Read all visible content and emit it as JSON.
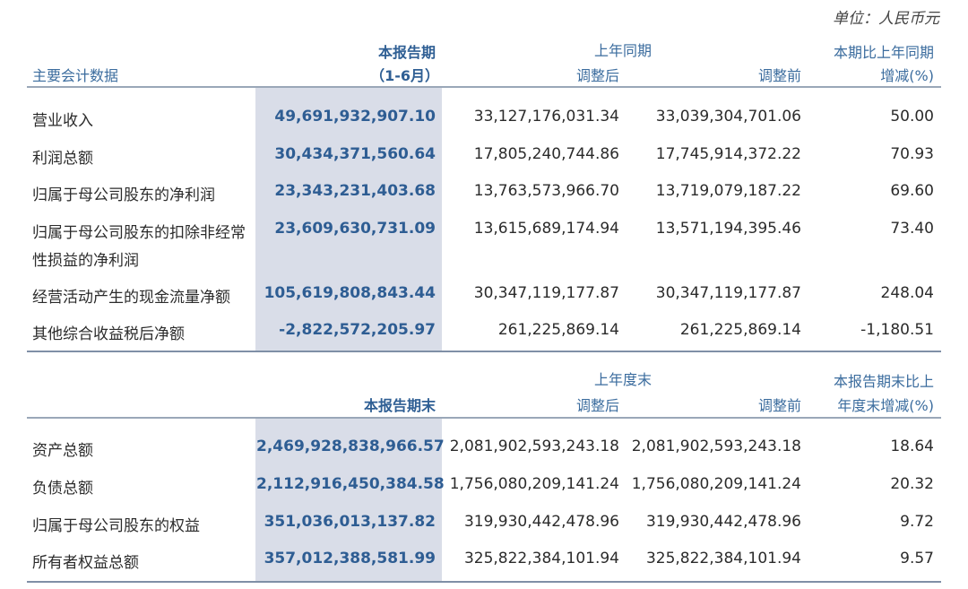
{
  "unit": "单位：人民币元",
  "section1": {
    "headers": {
      "item": "主要会计数据",
      "current_line1": "本报告期",
      "current_line2": "（1-6月）",
      "prior_group": "上年同期",
      "adjusted": "调整后",
      "before": "调整前",
      "change_line1": "本期比上年同期",
      "change_line2": "增减(%)"
    },
    "rows": [
      {
        "label": "营业收入",
        "current": "49,691,932,907.10",
        "adjusted": "33,127,176,031.34",
        "before": "33,039,304,701.06",
        "change": "50.00"
      },
      {
        "label": "利润总额",
        "current": "30,434,371,560.64",
        "adjusted": "17,805,240,744.86",
        "before": "17,745,914,372.22",
        "change": "70.93"
      },
      {
        "label": "归属于母公司股东的净利润",
        "current": "23,343,231,403.68",
        "adjusted": "13,763,573,966.70",
        "before": "13,719,079,187.22",
        "change": "69.60"
      },
      {
        "label": "归属于母公司股东的扣除非经常性损益的净利润",
        "current": "23,609,630,731.09",
        "adjusted": "13,615,689,174.94",
        "before": "13,571,194,395.46",
        "change": "73.40"
      },
      {
        "label": "经营活动产生的现金流量净额",
        "current": "105,619,808,843.44",
        "adjusted": "30,347,119,177.87",
        "before": "30,347,119,177.87",
        "change": "248.04"
      },
      {
        "label": "其他综合收益税后净额",
        "current": "-2,822,572,205.97",
        "adjusted": "261,225,869.14",
        "before": "261,225,869.14",
        "change": "-1,180.51"
      }
    ]
  },
  "section2": {
    "headers": {
      "current": "本报告期末",
      "prior_group": "上年度末",
      "adjusted": "调整后",
      "before": "调整前",
      "change_line1": "本报告期末比上",
      "change_line2": "年度末增减(%)"
    },
    "rows": [
      {
        "label": "资产总额",
        "current": "2,469,928,838,966.57",
        "adjusted": "2,081,902,593,243.18",
        "before": "2,081,902,593,243.18",
        "change": "18.64"
      },
      {
        "label": "负债总额",
        "current": "2,112,916,450,384.58",
        "adjusted": "1,756,080,209,141.24",
        "before": "1,756,080,209,141.24",
        "change": "20.32"
      },
      {
        "label": "归属于母公司股东的权益",
        "current": "351,036,013,137.82",
        "adjusted": "319,930,442,478.96",
        "before": "319,930,442,478.96",
        "change": "9.72"
      },
      {
        "label": "所有者权益总额",
        "current": "357,012,388,581.99",
        "adjusted": "325,822,384,101.94",
        "before": "325,822,384,101.94",
        "change": "9.57"
      }
    ]
  }
}
